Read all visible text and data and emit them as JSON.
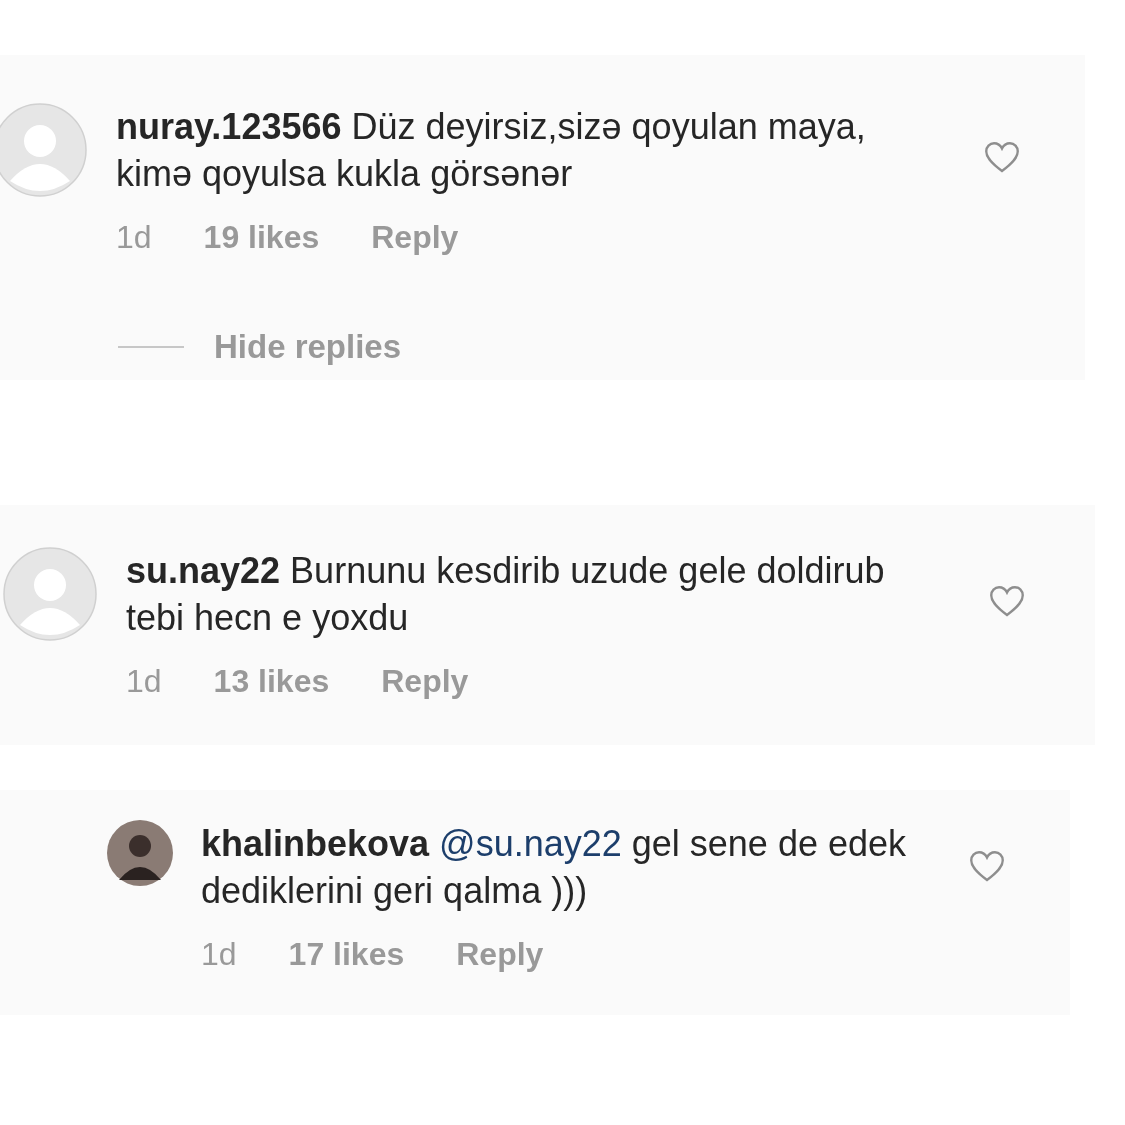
{
  "comments": [
    {
      "kind": "comment",
      "username": "nuray.123566",
      "text": "Düz deyirsiz,sizə qoyulan maya, kimə qoyulsa kukla görsənər",
      "time": "1d",
      "likes": "19 likes",
      "reply": "Reply",
      "liked": false,
      "hide_replies": "Hide replies"
    },
    {
      "kind": "comment",
      "username": "su.nay22",
      "text": "Burnunu kesdirib  uzude gele doldirub tebi hecn e yoxdu",
      "time": "1d",
      "likes": "13 likes",
      "reply": "Reply",
      "liked": false
    },
    {
      "kind": "reply",
      "username": "khalinbekova",
      "mention": "@su.nay22",
      "text": " gel sene de edek dediklerini geri qalma )))",
      "time": "1d",
      "likes": "17 likes",
      "reply": "Reply",
      "liked": false
    }
  ]
}
